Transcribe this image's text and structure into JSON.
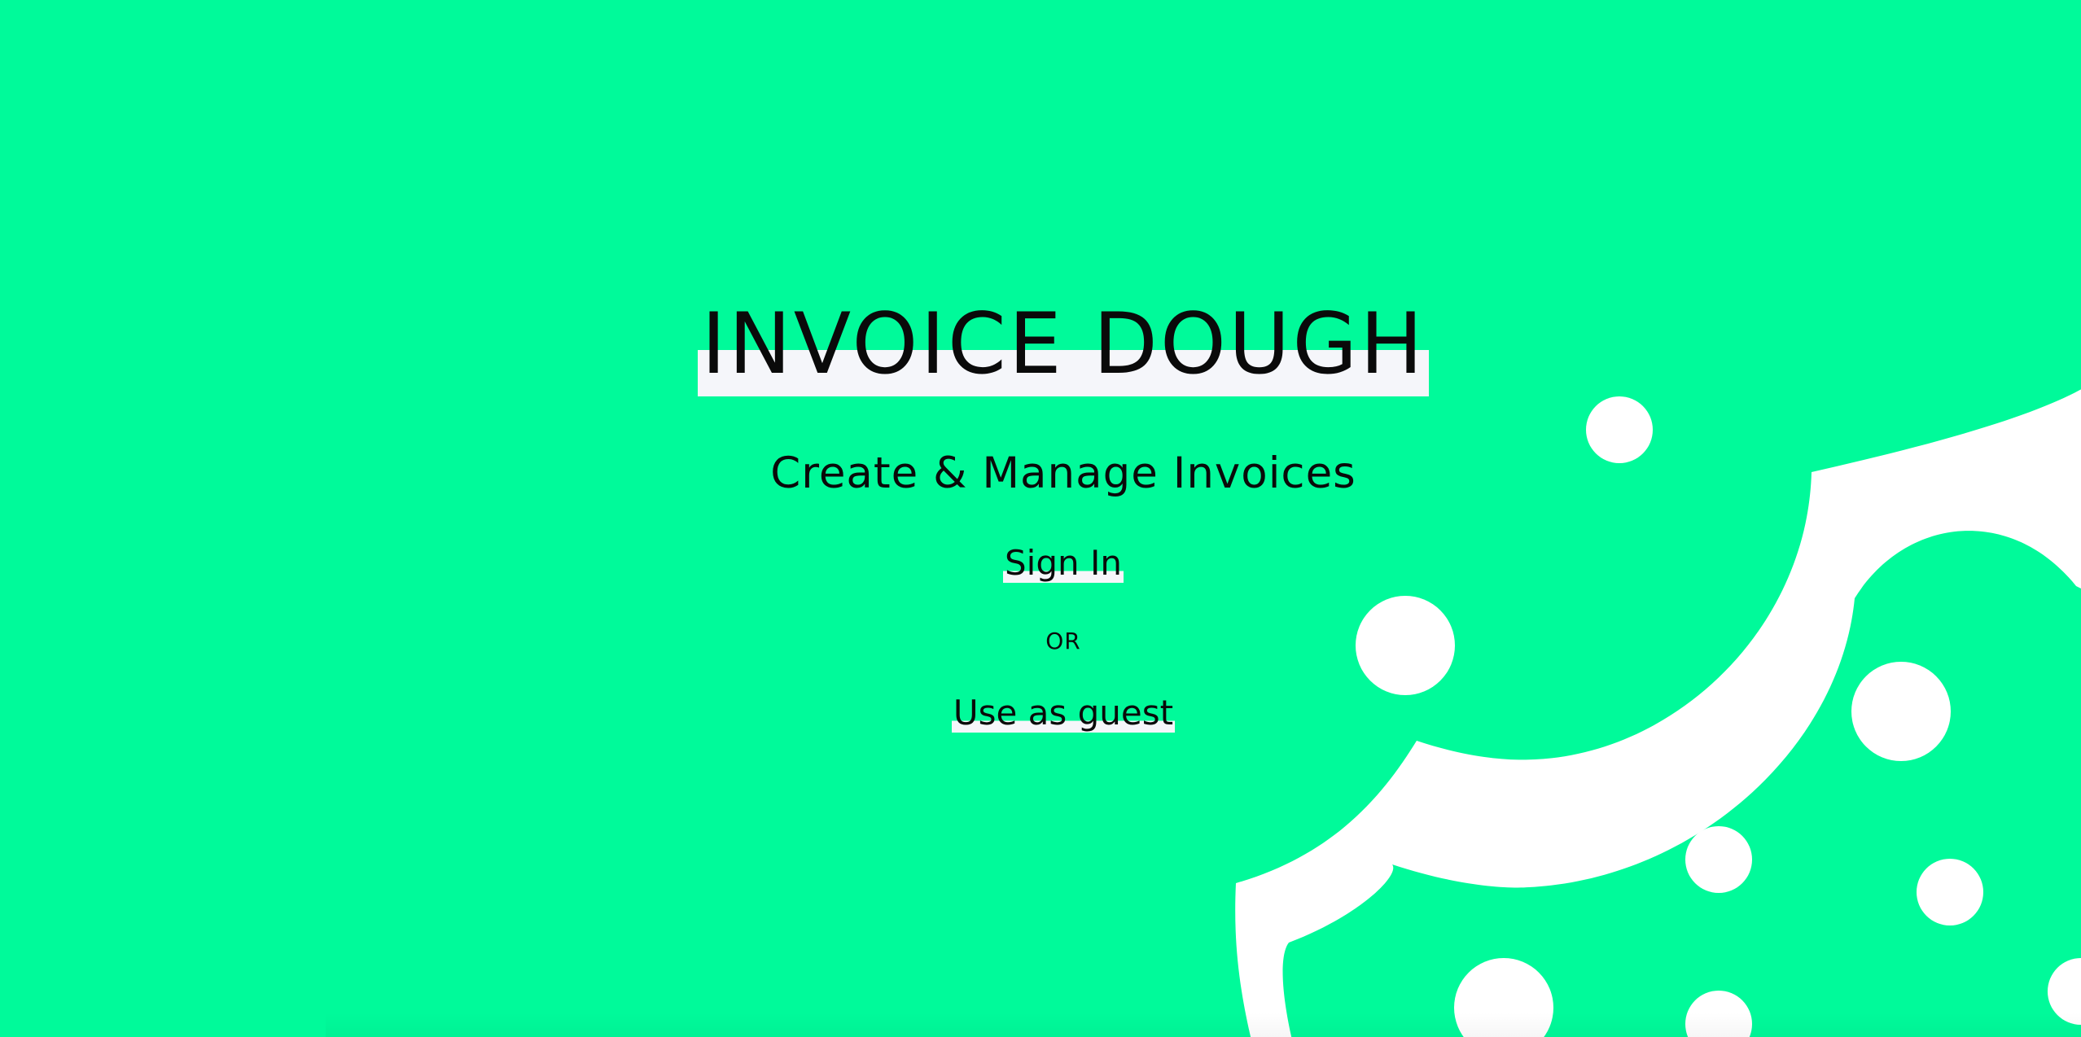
{
  "app": {
    "title": "INVOICE DOUGH",
    "tagline": "Create & Manage Invoices"
  },
  "auth": {
    "sign_in_label": "Sign In",
    "separator_label": "OR",
    "guest_label": "Use as guest"
  },
  "colors": {
    "background": "#00FA9A",
    "highlight": "#F5F6FA",
    "text": "#0a0a0a",
    "decoration": "#FFFFFF"
  },
  "decoration": {
    "icon": "cookie-icon"
  }
}
